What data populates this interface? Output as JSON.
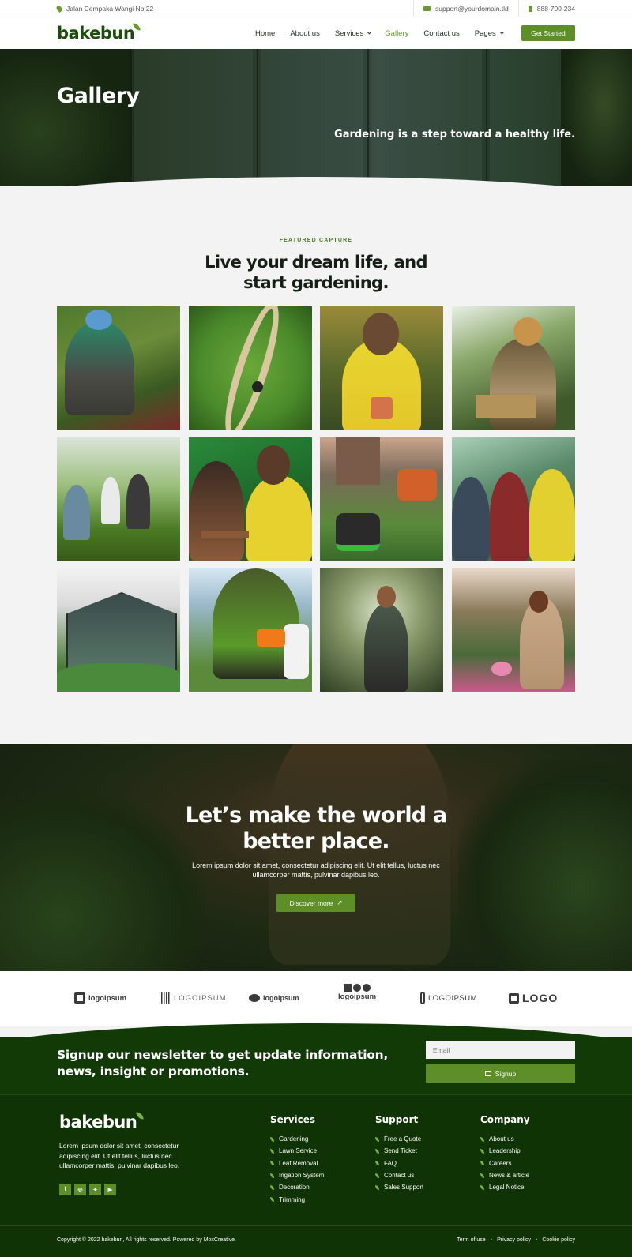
{
  "topbar": {
    "address": "Jalan Cempaka Wangi No 22",
    "email": "support@yourdomain.tld",
    "phone": "888-700-234"
  },
  "nav": {
    "logo": "bakebun",
    "items": [
      {
        "label": "Home"
      },
      {
        "label": "About us"
      },
      {
        "label": "Services"
      },
      {
        "label": "Gallery"
      },
      {
        "label": "Contact us"
      },
      {
        "label": "Pages"
      }
    ],
    "cta": "Get Started"
  },
  "hero": {
    "title": "Gallery",
    "tagline": "Gardening is a step toward a healthy life."
  },
  "gallery": {
    "eyebrow": "FEATURED CAPTURE",
    "title": "Live your dream life, and start gardening."
  },
  "cta": {
    "title": "Let’s make the world a better place.",
    "text": "Lorem ipsum dolor sit amet, consectetur adipiscing elit. Ut elit tellus, luctus nec ullamcorper mattis, pulvinar dapibus leo.",
    "button": "Discover more"
  },
  "partners": [
    {
      "label": "logoipsum"
    },
    {
      "label": "LOGOIPSUM"
    },
    {
      "label": "logoipsum"
    },
    {
      "label": "logoipsum"
    },
    {
      "label": "LOGOIPSUM"
    },
    {
      "label": "LOGO"
    }
  ],
  "newsletter": {
    "title": "Signup our newsletter to get update information, news, insight or promotions.",
    "placeholder": "Email",
    "button": "Signup"
  },
  "footer": {
    "logo": "bakebun",
    "description": "Lorem ipsum dolor sit amet, consectetur adipiscing elit. Ut elit tellus, luctus nec ullamcorper mattis, pulvinar dapibus leo.",
    "socials": [
      "f",
      "ig",
      "tw",
      "yt"
    ],
    "columns": [
      {
        "title": "Services",
        "links": [
          "Gardening",
          "Lawn Service",
          "Leaf Removal",
          "Irigation System",
          "Decoration",
          "Trimming"
        ]
      },
      {
        "title": "Support",
        "links": [
          "Free a Quote",
          "Send Ticket",
          "FAQ",
          "Contact us",
          "Sales Support"
        ]
      },
      {
        "title": "Company",
        "links": [
          "About us",
          "Leadership",
          "Careers",
          "News & article",
          "Legal Notice"
        ]
      }
    ],
    "copyright": "Copyright © 2022 bakebun, All rights reserved. Powered by MoxCreative.",
    "legal": [
      "Term of use",
      "Privacy policy",
      "Cookie policy"
    ]
  },
  "colors": {
    "accent": "#5e8e28",
    "dark_green": "#123a06",
    "text": "#1d2a1d"
  }
}
